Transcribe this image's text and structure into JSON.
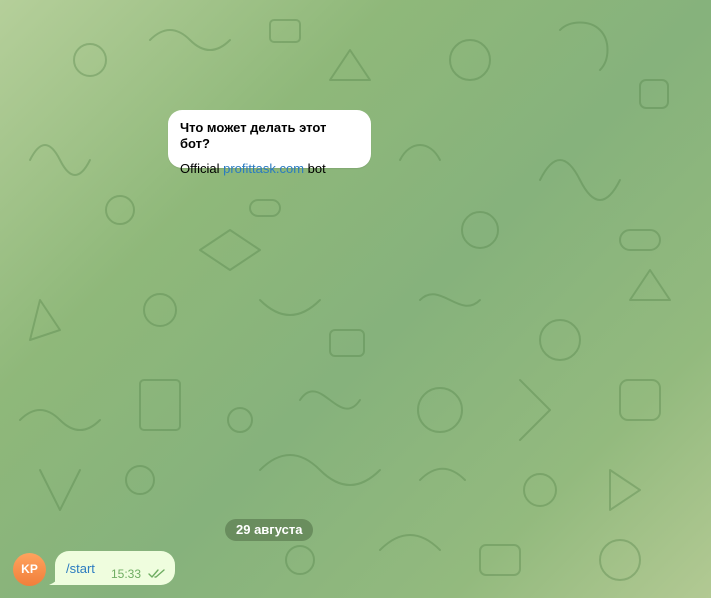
{
  "chat": {
    "bot_info": {
      "title": "Что может делать этот бот?",
      "desc_prefix": "Official ",
      "desc_link": "profittask.com",
      "desc_suffix": " bot"
    },
    "date_separator": "29 августа",
    "messages": [
      {
        "avatar_initials": "KP",
        "text": "/start",
        "time": "15:33",
        "status_icon": "double-check-icon"
      }
    ]
  },
  "colors": {
    "background": "#8fb87a",
    "bubble": "#effdde",
    "link": "#2b7bc0",
    "avatar": "#f17f3b",
    "time": "#6fad62"
  }
}
